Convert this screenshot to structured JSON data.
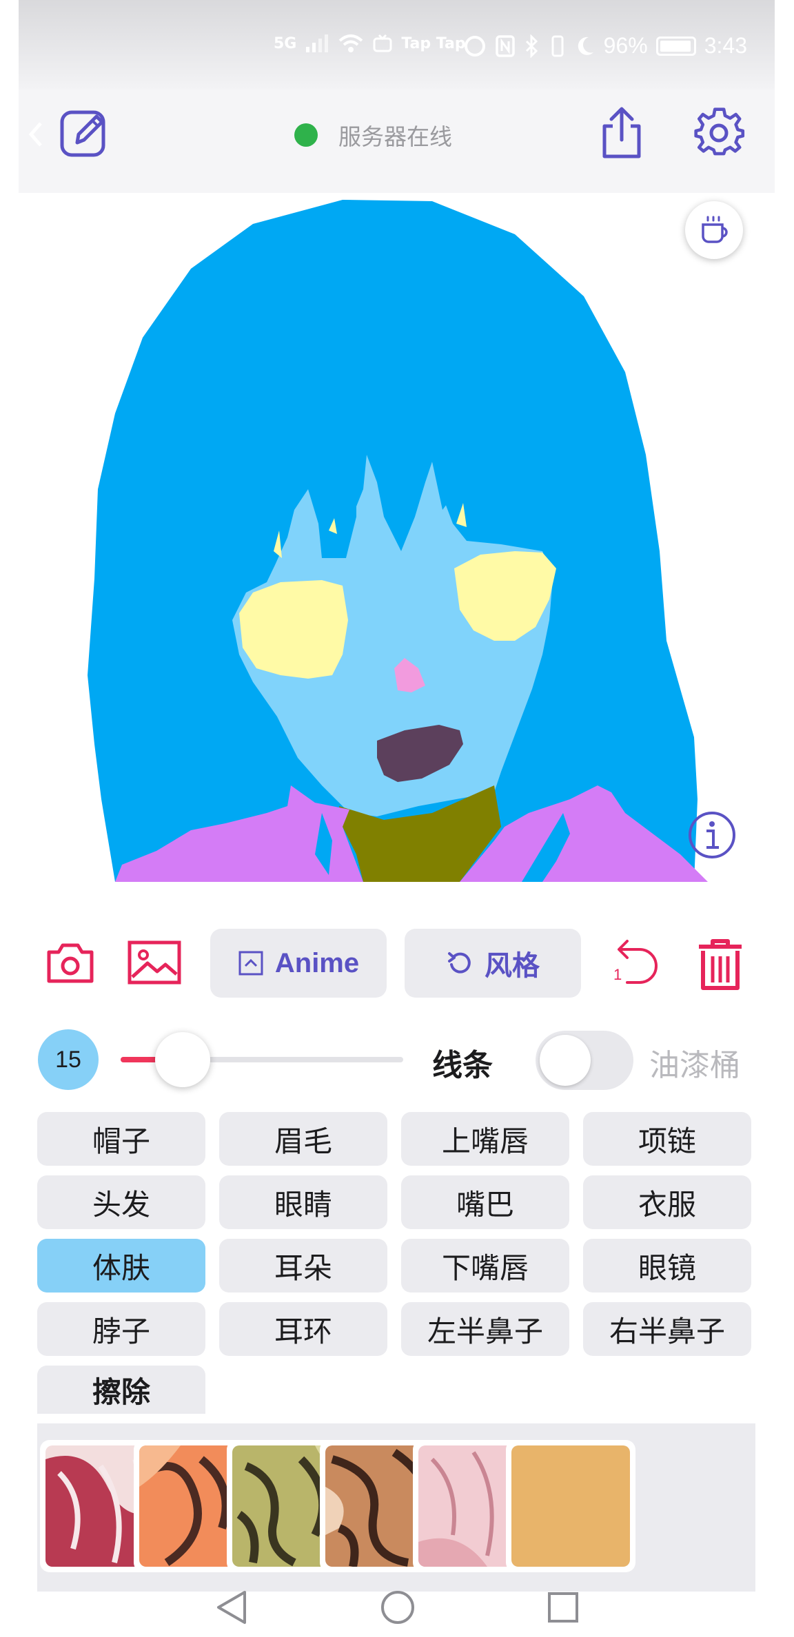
{
  "status_bar": {
    "network": "5G",
    "apps": "Tap Tap",
    "battery": "96%",
    "time": "3:43"
  },
  "header": {
    "server_status": "服务器在线",
    "status_color": "#2fb24b"
  },
  "toolbar": {
    "anime_label": "Anime",
    "style_label": "风格",
    "undo_count": "1"
  },
  "brush": {
    "size": "15",
    "slider_fraction": 0.22,
    "mode_lines": "线条",
    "mode_bucket": "油漆桶",
    "bucket_enabled": false
  },
  "parts": [
    {
      "label": "帽子"
    },
    {
      "label": "眉毛"
    },
    {
      "label": "上嘴唇"
    },
    {
      "label": "项链"
    },
    {
      "label": "头发"
    },
    {
      "label": "眼睛"
    },
    {
      "label": "嘴巴"
    },
    {
      "label": "衣服"
    },
    {
      "label": "体肤",
      "selected": true
    },
    {
      "label": "耳朵"
    },
    {
      "label": "下嘴唇"
    },
    {
      "label": "眼镜"
    },
    {
      "label": "脖子"
    },
    {
      "label": "耳环"
    },
    {
      "label": "左半鼻子"
    },
    {
      "label": "右半鼻子"
    }
  ],
  "erase_label": "擦除",
  "colors": {
    "accent": "#5a52c4",
    "danger": "#e6245a",
    "selected": "#86d0f7",
    "hair": "#00a8f3",
    "skin": "#80d3fb",
    "eyes": "#fffaa6",
    "clothes": "#d47cf6",
    "neck": "#808000",
    "mouth": "#5c405c",
    "nose": "#f29bde"
  }
}
